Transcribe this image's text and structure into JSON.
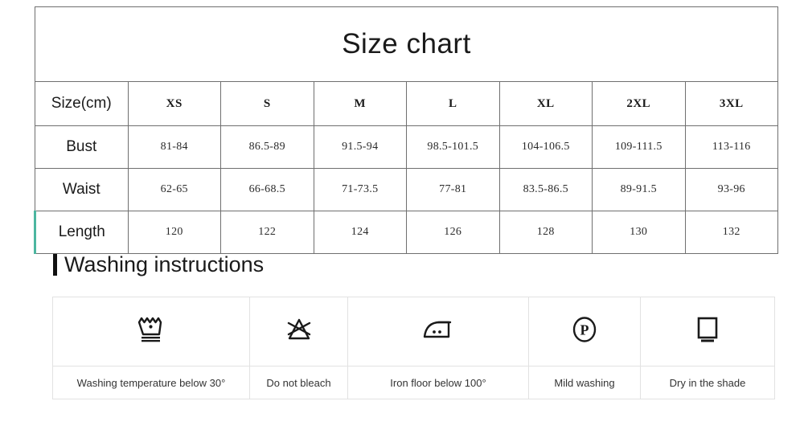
{
  "size_chart": {
    "title": "Size chart",
    "row_label_header": "Size(cm)",
    "sizes": [
      "XS",
      "S",
      "M",
      "L",
      "XL",
      "2XL",
      "3XL"
    ],
    "rows": [
      {
        "label": "Bust",
        "values": [
          "81-84",
          "86.5-89",
          "91.5-94",
          "98.5-101.5",
          "104-106.5",
          "109-111.5",
          "113-116"
        ]
      },
      {
        "label": "Waist",
        "values": [
          "62-65",
          "66-68.5",
          "71-73.5",
          "77-81",
          "83.5-86.5",
          "89-91.5",
          "93-96"
        ]
      },
      {
        "label": "Length",
        "values": [
          "120",
          "122",
          "124",
          "126",
          "128",
          "130",
          "132"
        ]
      }
    ],
    "accent_color": "#4cb6a0",
    "border_color": "#6f6f6f"
  },
  "washing": {
    "heading": "Washing instructions",
    "items": [
      {
        "icon": "wash-tub-30-icon",
        "label": "Washing temperature below 30°"
      },
      {
        "icon": "do-not-bleach-icon",
        "label": "Do not bleach"
      },
      {
        "icon": "iron-two-dots-icon",
        "label": "Iron floor below 100°"
      },
      {
        "icon": "dry-clean-p-icon",
        "label": "Mild washing"
      },
      {
        "icon": "dry-in-shade-icon",
        "label": "Dry in the shade"
      }
    ],
    "border_color": "#e2e2e2"
  }
}
